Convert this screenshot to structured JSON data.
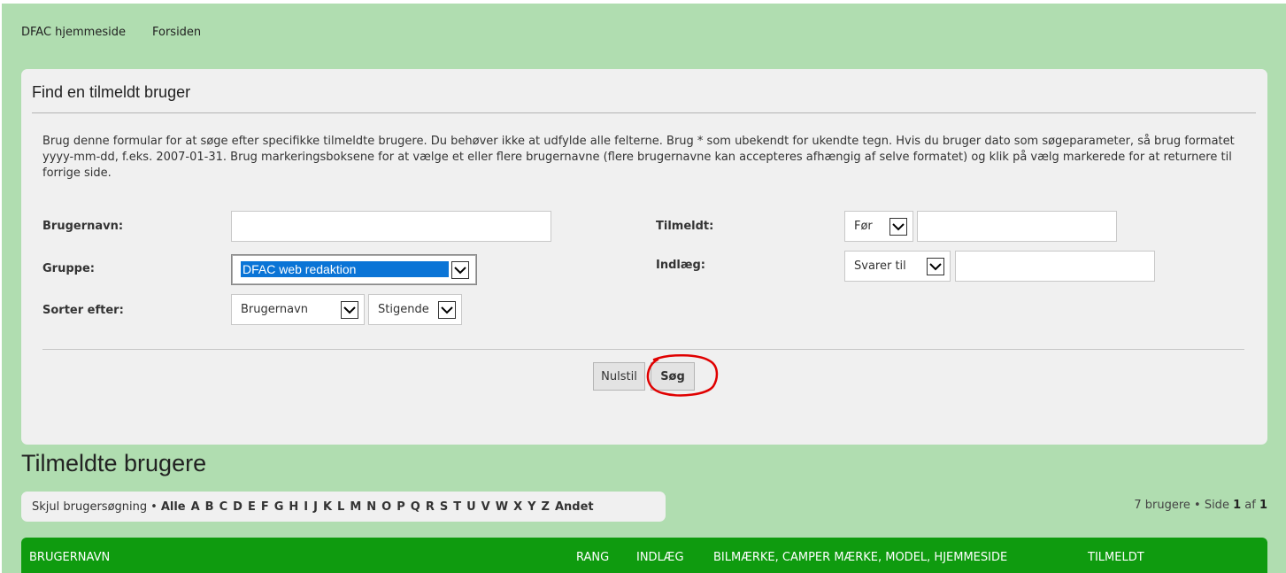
{
  "breadcrumb": {
    "home": "DFAC hjemmeside",
    "forum": "Forsiden"
  },
  "search_panel": {
    "title": "Find en tilmeldt bruger",
    "description": "Brug denne formular for at søge efter specifikke tilmeldte brugere. Du behøver ikke at udfylde alle felterne. Brug * som ubekendt for ukendte tegn. Hvis du bruger dato som søgeparameter, så brug formatet yyyy-mm-dd, f.eks. 2007-01-31. Brug markeringsboksene for at vælge et eller flere brugernavne (flere brugernavne kan accepteres afhængig af selve formatet) og klik på vælg markerede for at returnere til forrige side.",
    "username_label": "Brugernavn:",
    "username_value": "",
    "group_label": "Gruppe:",
    "group_value": "DFAC web redaktion",
    "sort_label": "Sorter efter:",
    "sort_field": "Brugernavn",
    "sort_order": "Stigende",
    "joined_label": "Tilmeldt:",
    "joined_operator": "Før",
    "joined_value": "",
    "posts_label": "Indlæg:",
    "posts_operator": "Svarer til",
    "posts_value": "",
    "reset_button": "Nulstil",
    "search_button": "Søg"
  },
  "members": {
    "heading": "Tilmeldte brugere",
    "hide_search": "Skjul brugersøgning",
    "bullet": "•",
    "letters": [
      "Alle",
      "A",
      "B",
      "C",
      "D",
      "E",
      "F",
      "G",
      "H",
      "I",
      "J",
      "K",
      "L",
      "M",
      "N",
      "O",
      "P",
      "Q",
      "R",
      "S",
      "T",
      "U",
      "V",
      "W",
      "X",
      "Y",
      "Z",
      "Andet"
    ],
    "pagination": {
      "count_text": "7 brugere • Side",
      "current_page": "1",
      "of_text": "af",
      "total_pages": "1"
    },
    "columns": {
      "username": "BRUGERNAVN",
      "rank": "RANG",
      "posts": "INDLÆG",
      "car": "BILMÆRKE, CAMPER MÆRKE, MODEL, HJEMMESIDE",
      "joined": "TILMELDT"
    }
  },
  "colors": {
    "page_background": "#b0ddb0",
    "panel_background": "#f0f0f0",
    "table_header": "#0f9b0f",
    "selection": "#0a74d6",
    "annotation": "#e00000"
  }
}
